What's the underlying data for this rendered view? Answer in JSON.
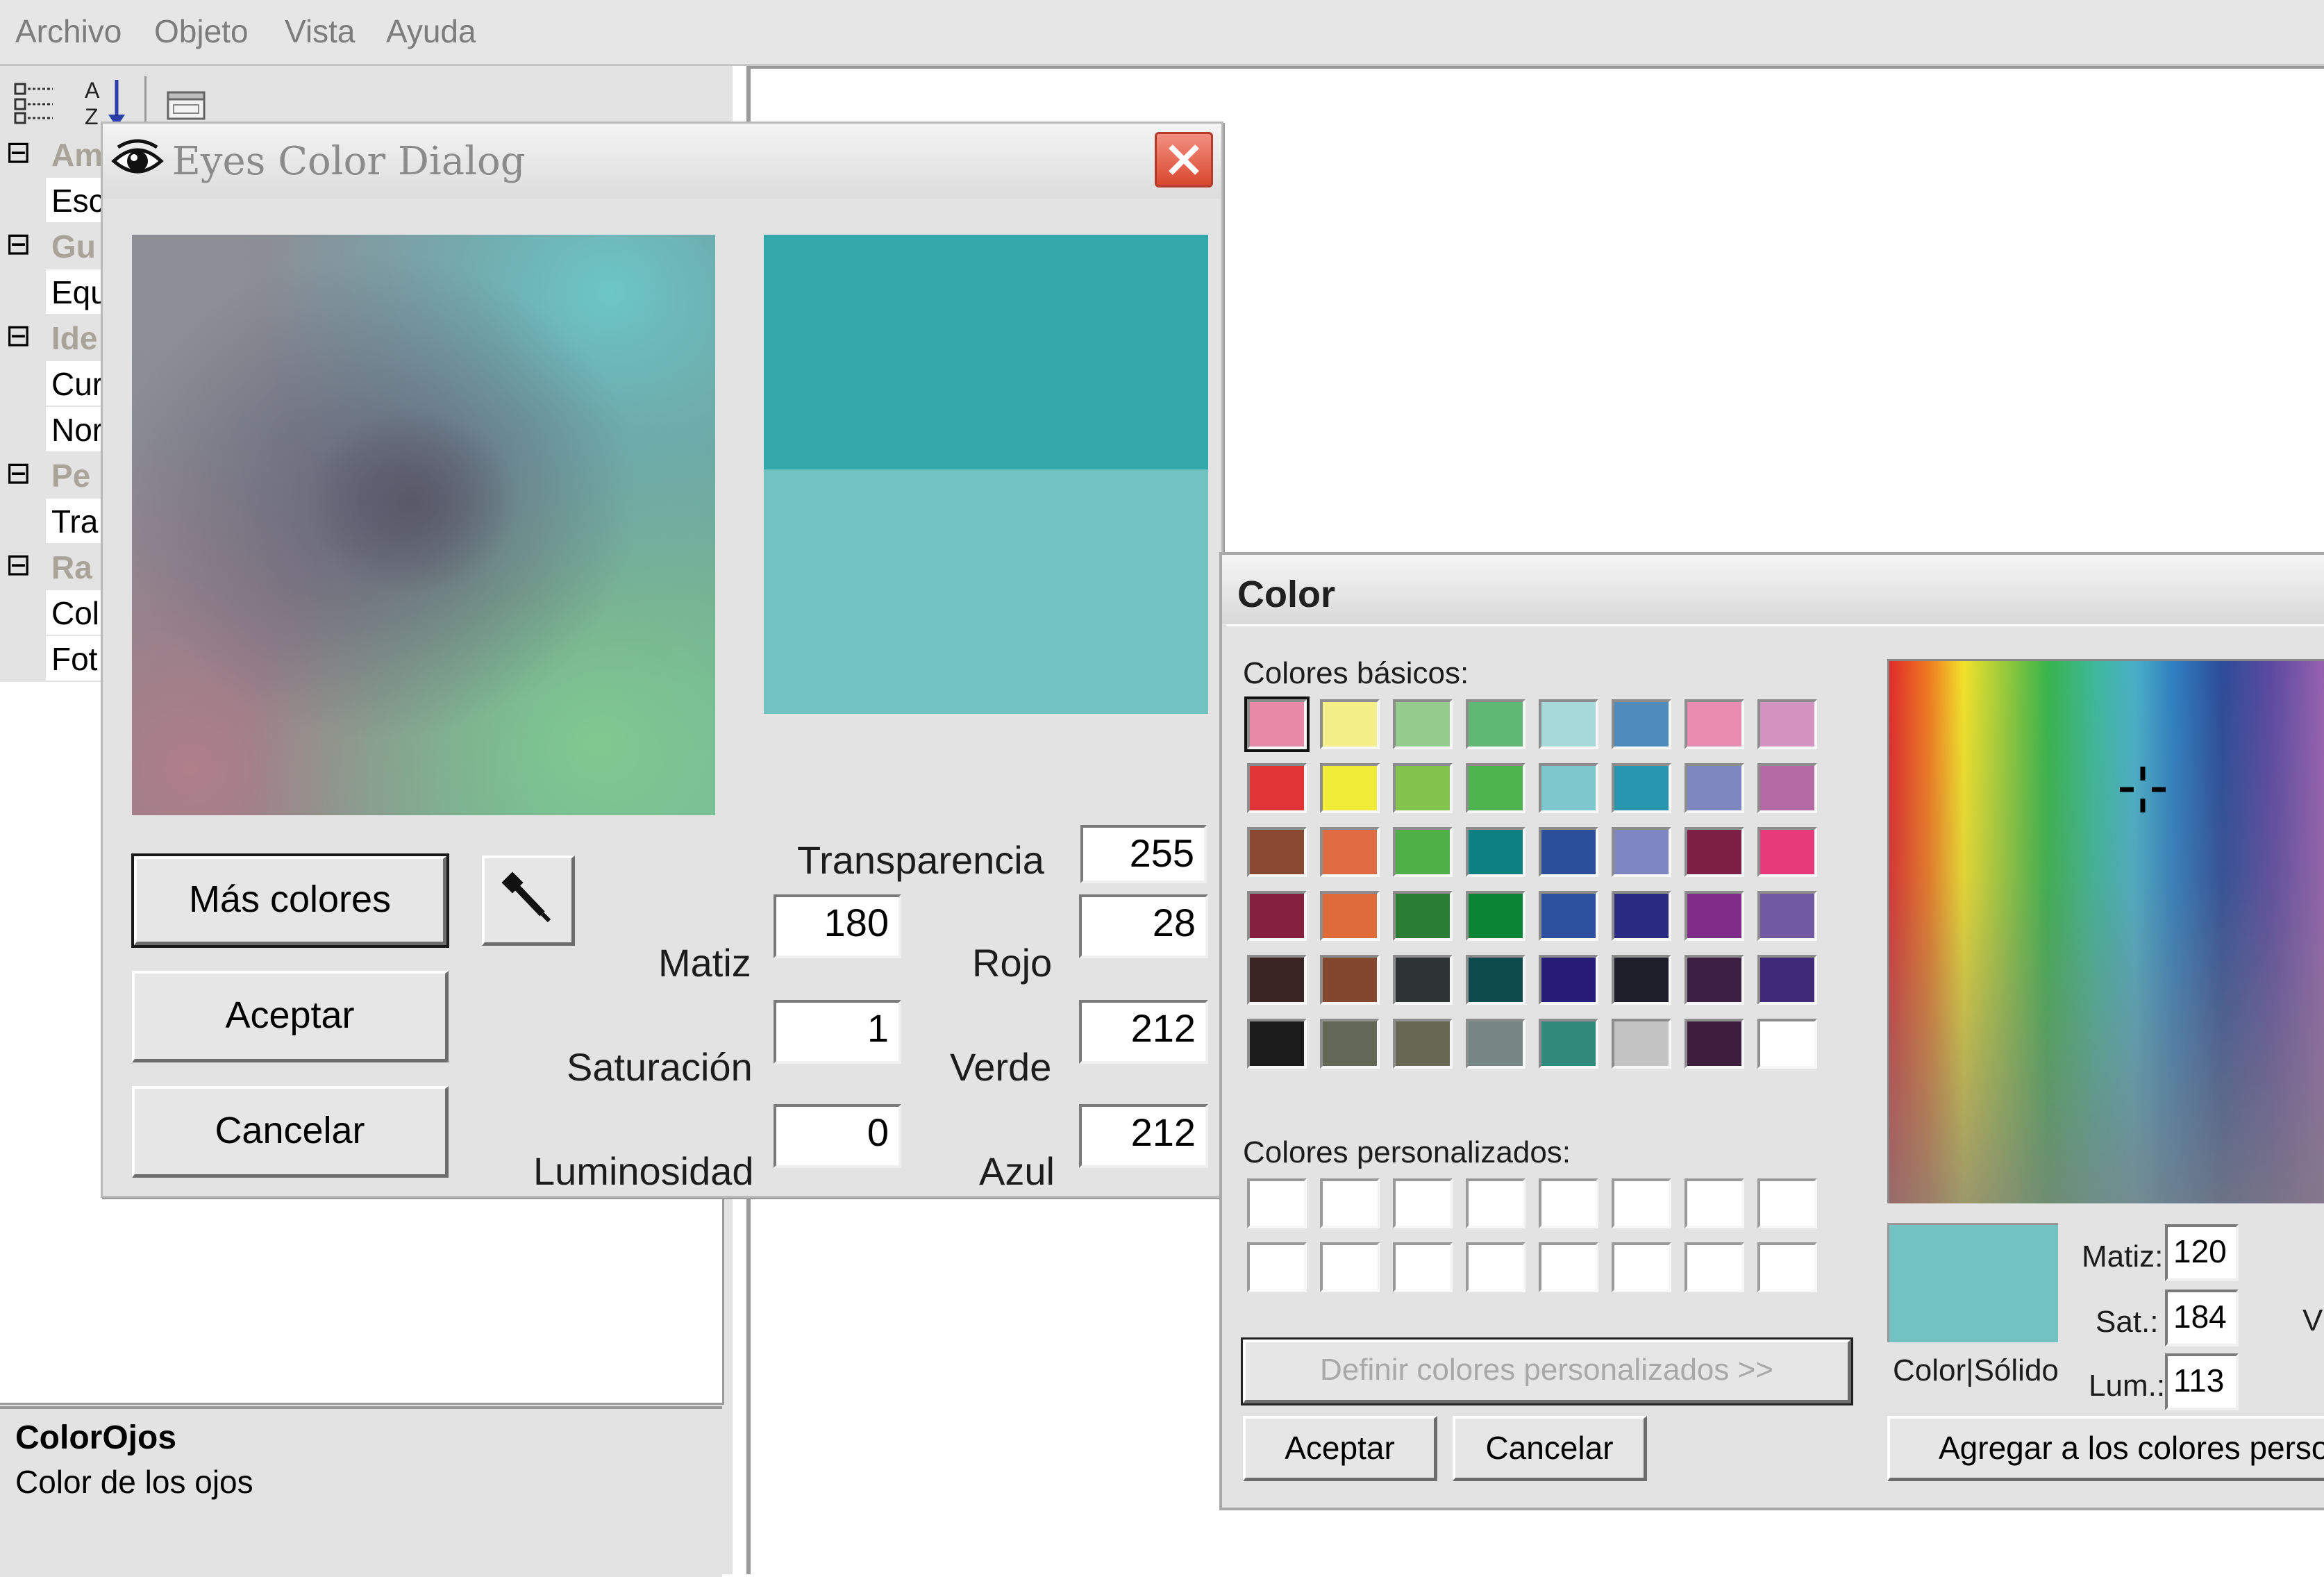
{
  "menu": [
    "Archivo",
    "Objeto",
    "Vista",
    "Ayuda"
  ],
  "tree": {
    "rows": [
      {
        "expander": "⊟",
        "label": "Am",
        "type": "category"
      },
      {
        "expander": "",
        "label": "Esc",
        "type": "property"
      },
      {
        "expander": "⊟",
        "label": "Gu",
        "type": "category"
      },
      {
        "expander": "",
        "label": "Equ",
        "type": "property"
      },
      {
        "expander": "⊟",
        "label": "Ide",
        "type": "category"
      },
      {
        "expander": "",
        "label": "Cur",
        "type": "property"
      },
      {
        "expander": "",
        "label": "Nor",
        "type": "property"
      },
      {
        "expander": "⊟",
        "label": "Pe",
        "type": "category"
      },
      {
        "expander": "",
        "label": "Tra",
        "type": "property"
      },
      {
        "expander": "⊟",
        "label": "Ra",
        "type": "category"
      },
      {
        "expander": "",
        "label": "Col",
        "type": "property"
      },
      {
        "expander": "",
        "label": "Fot",
        "type": "property"
      }
    ]
  },
  "description": {
    "title": "ColorOjos",
    "text": "Color de los ojos"
  },
  "eyes_dialog": {
    "title": "Eyes Color Dialog",
    "close_label": "✕",
    "preview_top_color": "#32a8aa",
    "preview_bottom_color": "#72c2c2",
    "transparency_label": "Transparencia",
    "transparency_value": "255",
    "hue_label": "Matiz",
    "hue_value": "180",
    "saturation_label": "Saturación",
    "saturation_value": "1",
    "luminosity_label": "Luminosidad",
    "luminosity_value": "0",
    "red_label": "Rojo",
    "red_value": "28",
    "green_label": "Verde",
    "green_value": "212",
    "blue_label": "Azul",
    "blue_value": "212",
    "more_colors": "Más colores",
    "accept": "Aceptar",
    "cancel": "Cancelar"
  },
  "color_dialog": {
    "title": "Color",
    "basic_label": "Colores básicos:",
    "custom_label": "Colores personalizados:",
    "basic_colors": [
      "#e889a8",
      "#f4ef88",
      "#93cc8c",
      "#5fb874",
      "#a6d9da",
      "#4d8cbc",
      "#e88cb0",
      "#d392c0",
      "#e03437",
      "#f1ec38",
      "#84c44e",
      "#4eb44e",
      "#7dc8cc",
      "#2796ae",
      "#7e87c0",
      "#b56aa6",
      "#8a4931",
      "#df6b42",
      "#50b048",
      "#0c7f83",
      "#2b4f98",
      "#7e87c4",
      "#7e1f45",
      "#e73a7a",
      "#85203f",
      "#df6b3a",
      "#2a7e34",
      "#0b8436",
      "#2c4f9e",
      "#2c2b84",
      "#7f2d88",
      "#7159a3",
      "#3a2424",
      "#83462e",
      "#2e3433",
      "#0b4b4b",
      "#271b78",
      "#1d1e2a",
      "#3d1f44",
      "#3f2a7a",
      "#1b1b1b",
      "#636856",
      "#676853",
      "#768786",
      "#30897a",
      "#c4c4c4",
      "#3c1d3e",
      "#ffffff"
    ],
    "selected_color": "#72c2c2",
    "solid_label": "Color|Sólido",
    "hue_label": "Matiz:",
    "hue_value": "120",
    "sat_label": "Sat.:",
    "sat_value": "184",
    "lum_label": "Lum.:",
    "lum_value": "113",
    "cut_label": "V",
    "define_custom": "Definir colores personalizados >>",
    "accept": "Aceptar",
    "cancel": "Cancelar",
    "add_custom": "Agregar a los colores perso"
  }
}
